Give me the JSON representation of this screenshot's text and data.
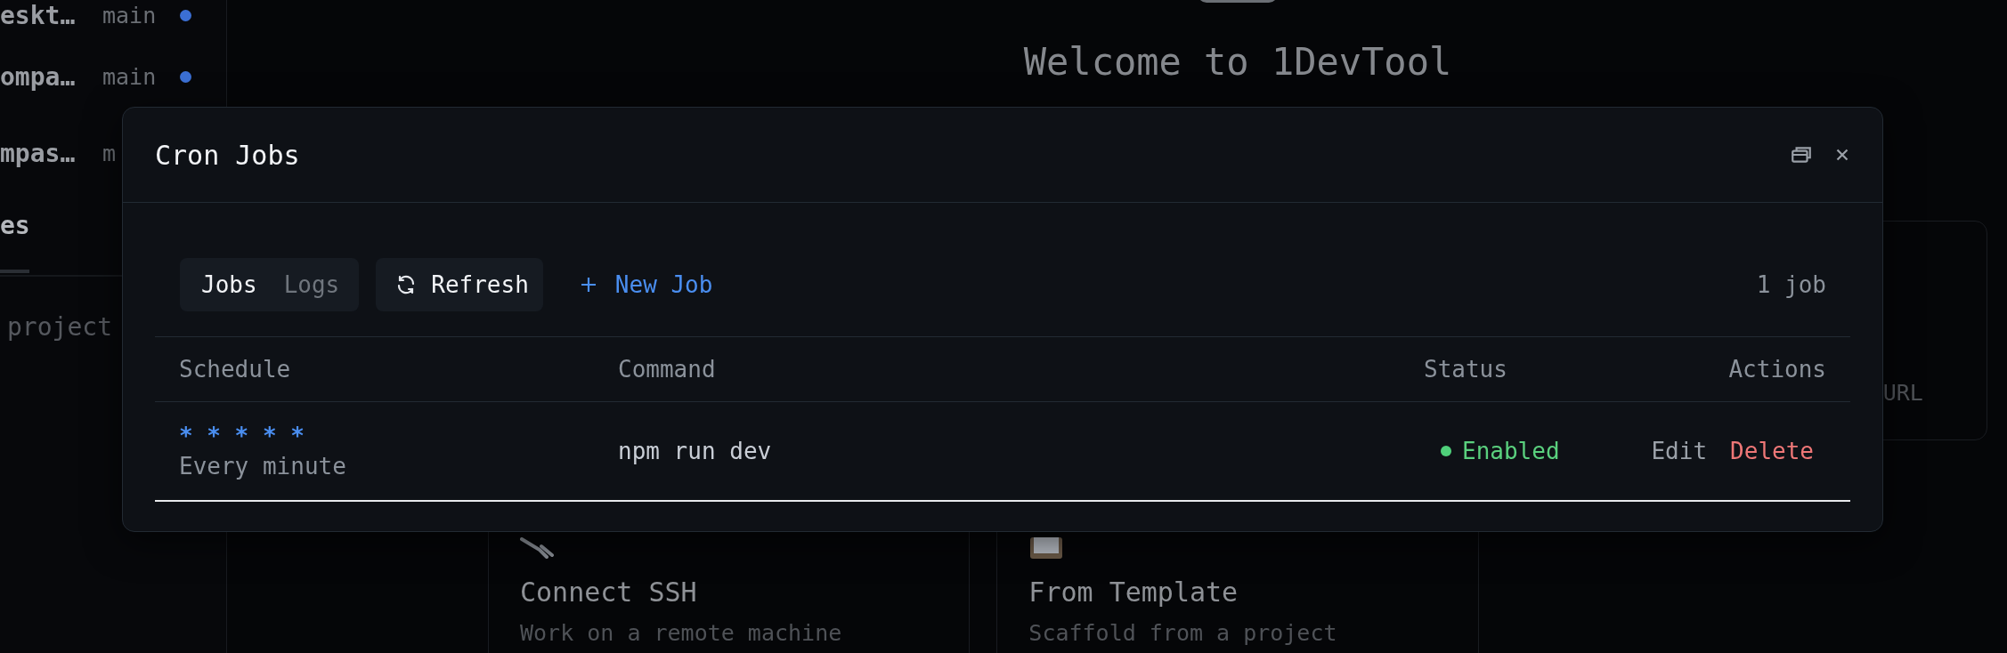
{
  "sidebar": {
    "projects": [
      {
        "name": "eskt…",
        "branch": "main",
        "color": "#3b6fd4"
      },
      {
        "name": "ompa…",
        "branch": "main",
        "color": "#3b6fd4"
      },
      {
        "name": "mpas…",
        "branch": "m"
      }
    ],
    "section_title": "es",
    "hint": "project"
  },
  "main": {
    "title": "Welcome to 1DevTool",
    "cards": [
      {
        "description": "URL"
      },
      {
        "title": "Connect SSH",
        "description": "Work on a remote machine",
        "kind": "ssh"
      },
      {
        "title": "From Template",
        "description": "Scaffold from a project",
        "kind": "template"
      }
    ]
  },
  "modal": {
    "title": "Cron Jobs",
    "tabs": [
      {
        "label": "Jobs",
        "selected": true
      },
      {
        "label": "Logs",
        "selected": false
      }
    ],
    "refresh_button": "Refresh",
    "new_job_button": "New Job",
    "job_count": "1 job",
    "table": {
      "columns": [
        "Schedule",
        "Command",
        "Status",
        "Actions"
      ],
      "rows": [
        {
          "schedule": "* * * * *",
          "schedule_description": "Every minute",
          "command": "npm run dev",
          "status": "Enabled",
          "enabled": true,
          "actions": [
            {
              "label": "Edit",
              "kind": "edit"
            },
            {
              "label": "Delete",
              "kind": "delete"
            }
          ]
        }
      ]
    }
  }
}
